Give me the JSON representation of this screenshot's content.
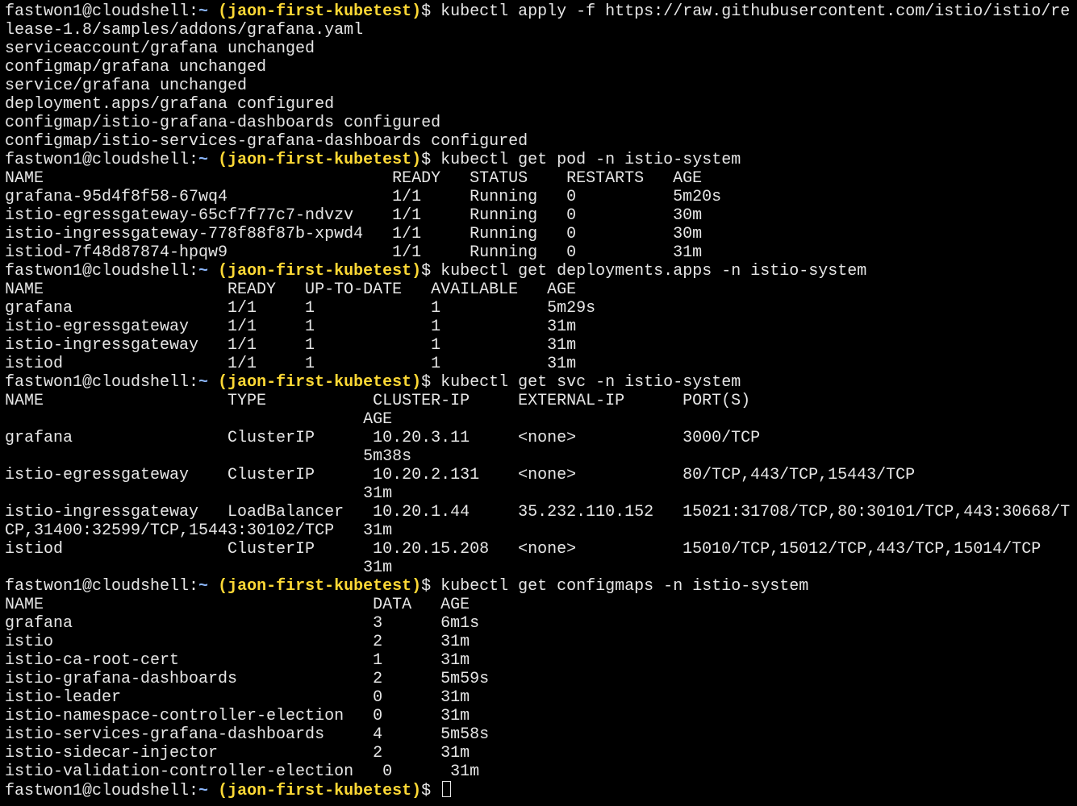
{
  "prompt": {
    "user_host": "fastwon1@cloudshell:",
    "path": "~",
    "project": "(jaon-first-kubetest)",
    "symbol": "$ "
  },
  "lines": [
    {
      "type": "prompt",
      "cmd": "kubectl apply -f https://raw.githubusercontent.com/istio/istio/re"
    },
    {
      "type": "output",
      "text": "lease-1.8/samples/addons/grafana.yaml"
    },
    {
      "type": "output",
      "text": "serviceaccount/grafana unchanged"
    },
    {
      "type": "output",
      "text": "configmap/grafana unchanged"
    },
    {
      "type": "output",
      "text": "service/grafana unchanged"
    },
    {
      "type": "output",
      "text": "deployment.apps/grafana configured"
    },
    {
      "type": "output",
      "text": "configmap/istio-grafana-dashboards configured"
    },
    {
      "type": "output",
      "text": "configmap/istio-services-grafana-dashboards configured"
    },
    {
      "type": "prompt",
      "cmd": "kubectl get pod -n istio-system"
    },
    {
      "type": "output",
      "text": "NAME                                    READY   STATUS    RESTARTS   AGE"
    },
    {
      "type": "output",
      "text": "grafana-95d4f8f58-67wq4                 1/1     Running   0          5m20s"
    },
    {
      "type": "output",
      "text": "istio-egressgateway-65cf7f77c7-ndvzv    1/1     Running   0          30m"
    },
    {
      "type": "output",
      "text": "istio-ingressgateway-778f88f87b-xpwd4   1/1     Running   0          30m"
    },
    {
      "type": "output",
      "text": "istiod-7f48d87874-hpqw9                 1/1     Running   0          31m"
    },
    {
      "type": "prompt",
      "cmd": "kubectl get deployments.apps -n istio-system"
    },
    {
      "type": "output",
      "text": "NAME                   READY   UP-TO-DATE   AVAILABLE   AGE"
    },
    {
      "type": "output",
      "text": "grafana                1/1     1            1           5m29s"
    },
    {
      "type": "output",
      "text": "istio-egressgateway    1/1     1            1           31m"
    },
    {
      "type": "output",
      "text": "istio-ingressgateway   1/1     1            1           31m"
    },
    {
      "type": "output",
      "text": "istiod                 1/1     1            1           31m"
    },
    {
      "type": "prompt",
      "cmd": "kubectl get svc -n istio-system"
    },
    {
      "type": "output",
      "text": "NAME                   TYPE           CLUSTER-IP     EXTERNAL-IP      PORT(S)"
    },
    {
      "type": "output",
      "text": "                                     AGE"
    },
    {
      "type": "output",
      "text": "grafana                ClusterIP      10.20.3.11     <none>           3000/TCP"
    },
    {
      "type": "output",
      "text": "                                     5m38s"
    },
    {
      "type": "output",
      "text": "istio-egressgateway    ClusterIP      10.20.2.131    <none>           80/TCP,443/TCP,15443/TCP"
    },
    {
      "type": "output",
      "text": "                                     31m"
    },
    {
      "type": "output",
      "text": "istio-ingressgateway   LoadBalancer   10.20.1.44     35.232.110.152   15021:31708/TCP,80:30101/TCP,443:30668/T"
    },
    {
      "type": "output",
      "text": "CP,31400:32599/TCP,15443:30102/TCP   31m"
    },
    {
      "type": "output",
      "text": "istiod                 ClusterIP      10.20.15.208   <none>           15010/TCP,15012/TCP,443/TCP,15014/TCP"
    },
    {
      "type": "output",
      "text": "                                     31m"
    },
    {
      "type": "prompt",
      "cmd": "kubectl get configmaps -n istio-system"
    },
    {
      "type": "output",
      "text": "NAME                                  DATA   AGE"
    },
    {
      "type": "output",
      "text": "grafana                               3      6m1s"
    },
    {
      "type": "output",
      "text": "istio                                 2      31m"
    },
    {
      "type": "output",
      "text": "istio-ca-root-cert                    1      31m"
    },
    {
      "type": "output",
      "text": "istio-grafana-dashboards              2      5m59s"
    },
    {
      "type": "output",
      "text": "istio-leader                          0      31m"
    },
    {
      "type": "output",
      "text": "istio-namespace-controller-election   0      31m"
    },
    {
      "type": "output",
      "text": "istio-services-grafana-dashboards     4      5m58s"
    },
    {
      "type": "output",
      "text": "istio-sidecar-injector                2      31m"
    },
    {
      "type": "output",
      "text": "istio-validation-controller-election   0      31m"
    },
    {
      "type": "prompt",
      "cmd": "",
      "cursor": true
    }
  ]
}
